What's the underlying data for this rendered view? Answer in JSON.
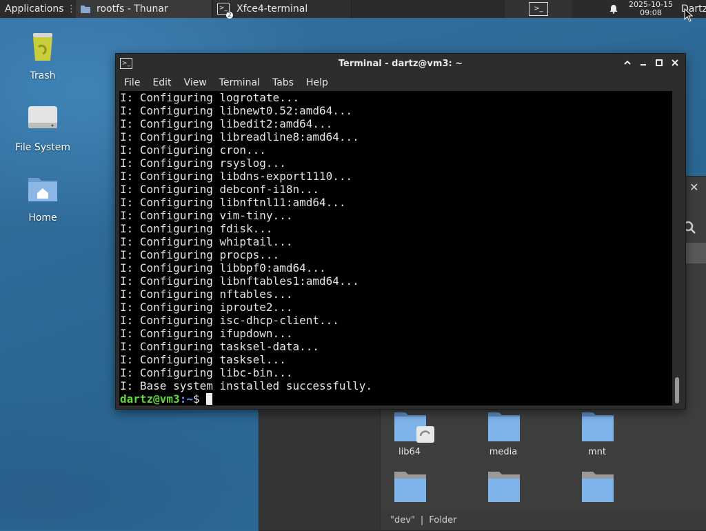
{
  "panel": {
    "applications_label": "Applications",
    "tasks": [
      {
        "label": "rootfs - Thunar"
      },
      {
        "label": "Xfce4-terminal",
        "badge": "2"
      }
    ],
    "clock_date": "2025-10-15",
    "clock_time": "09:08",
    "user_label": "Dartz"
  },
  "desktop": {
    "icons": [
      {
        "label": "Trash"
      },
      {
        "label": "File System"
      },
      {
        "label": "Home"
      }
    ]
  },
  "thunar": {
    "folders": [
      {
        "label": "lib64"
      },
      {
        "label": "media"
      },
      {
        "label": "mnt"
      },
      {
        "label": ""
      },
      {
        "label": ""
      },
      {
        "label": ""
      }
    ],
    "status_name": "\"dev\"",
    "status_sep": "|",
    "status_type": "Folder"
  },
  "terminal": {
    "title": "Terminal - dartz@vm3: ~",
    "menu": [
      "File",
      "Edit",
      "View",
      "Terminal",
      "Tabs",
      "Help"
    ],
    "lines": [
      "I: Configuring logrotate...",
      "I: Configuring libnewt0.52:amd64...",
      "I: Configuring libedit2:amd64...",
      "I: Configuring libreadline8:amd64...",
      "I: Configuring cron...",
      "I: Configuring rsyslog...",
      "I: Configuring libdns-export1110...",
      "I: Configuring debconf-i18n...",
      "I: Configuring libnftnl11:amd64...",
      "I: Configuring vim-tiny...",
      "I: Configuring fdisk...",
      "I: Configuring whiptail...",
      "I: Configuring procps...",
      "I: Configuring libbpf0:amd64...",
      "I: Configuring libnftables1:amd64...",
      "I: Configuring nftables...",
      "I: Configuring iproute2...",
      "I: Configuring isc-dhcp-client...",
      "I: Configuring ifupdown...",
      "I: Configuring tasksel-data...",
      "I: Configuring tasksel...",
      "I: Configuring libc-bin...",
      "I: Base system installed successfully."
    ],
    "prompt_user": "dartz@vm3",
    "prompt_path": ":~",
    "prompt_symbol": "$ "
  },
  "colors": {
    "prompt_green": "#5ed83a",
    "prompt_blue": "#6b8cff",
    "folder_blue": "#7fb4ea"
  },
  "icons": [
    "xfce-logo-icon",
    "folder-icon",
    "terminal-icon",
    "bell-icon",
    "cursor-icon",
    "search-icon",
    "close-icon"
  ]
}
